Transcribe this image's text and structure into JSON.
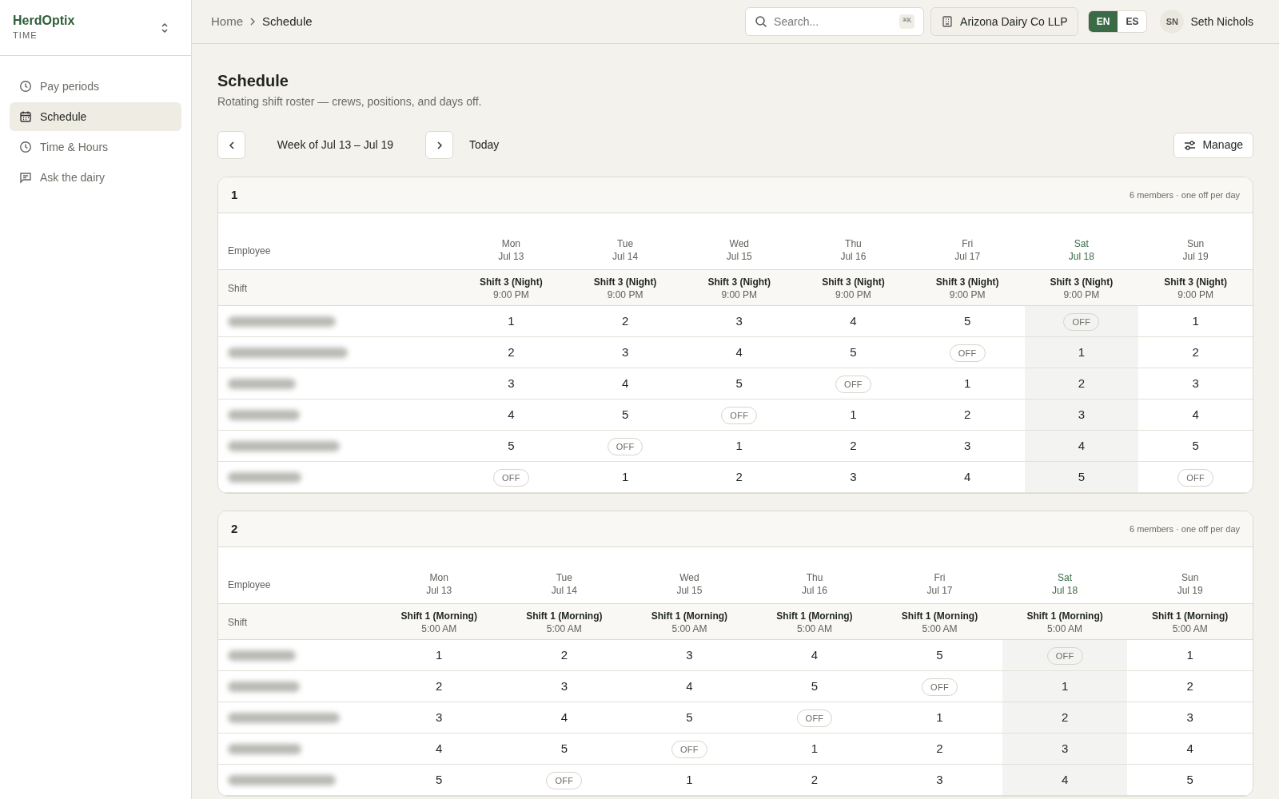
{
  "sidebar": {
    "brand": "HerdOptix",
    "product": "TIME",
    "items": [
      {
        "label": "Pay periods",
        "selected": false
      },
      {
        "label": "Schedule",
        "selected": true
      },
      {
        "label": "Time & Hours",
        "selected": false
      },
      {
        "label": "Ask the dairy",
        "selected": false
      }
    ]
  },
  "breadcrumb": [
    "Home",
    "Schedule"
  ],
  "topbar": {
    "search_placeholder": "Search...",
    "shortcut": "⌘K",
    "organization": "Arizona Dairy Co LLP",
    "languages": [
      {
        "label": "EN",
        "selected": true
      },
      {
        "label": "ES",
        "selected": false
      }
    ],
    "user_initials": "SN",
    "user_name": "Seth Nichols"
  },
  "page": {
    "title": "Schedule",
    "subtitle": "Rotating shift roster — crews, positions, and days off.",
    "week": "Week of Jul 13 – Jul 19",
    "today_button": "Today",
    "manage_button": "Manage"
  },
  "crews": [
    {
      "title": "1",
      "meta": "6 members · one off per day",
      "employee_header": "Employee",
      "shift_header": "Shift",
      "days": [
        {
          "day": "Mon",
          "date": "Jul 13",
          "shift": "Shift 3 (Night)",
          "time": "9:00 PM",
          "today": false
        },
        {
          "day": "Tue",
          "date": "Jul 14",
          "shift": "Shift 3 (Night)",
          "time": "9:00 PM",
          "today": false
        },
        {
          "day": "Wed",
          "date": "Jul 15",
          "shift": "Shift 3 (Night)",
          "time": "9:00 PM",
          "today": false
        },
        {
          "day": "Thu",
          "date": "Jul 16",
          "shift": "Shift 3 (Night)",
          "time": "9:00 PM",
          "today": false
        },
        {
          "day": "Fri",
          "date": "Jul 17",
          "shift": "Shift 3 (Night)",
          "time": "9:00 PM",
          "today": false
        },
        {
          "day": "Sat",
          "date": "Jul 18",
          "shift": "Shift 3 (Night)",
          "time": "9:00 PM",
          "today": true
        },
        {
          "day": "Sun",
          "date": "Jul 19",
          "shift": "Shift 3 (Night)",
          "time": "9:00 PM",
          "today": false
        }
      ],
      "rows": [
        {
          "cells": [
            {
              "kind": "position",
              "text": "1"
            },
            {
              "kind": "position",
              "text": "2"
            },
            {
              "kind": "position",
              "text": "3"
            },
            {
              "kind": "position",
              "text": "4"
            },
            {
              "kind": "position",
              "text": "5"
            },
            {
              "kind": "off",
              "text": "OFF"
            },
            {
              "kind": "position",
              "text": "1"
            }
          ]
        },
        {
          "cells": [
            {
              "kind": "position",
              "text": "2"
            },
            {
              "kind": "position",
              "text": "3"
            },
            {
              "kind": "position",
              "text": "4"
            },
            {
              "kind": "position",
              "text": "5"
            },
            {
              "kind": "off",
              "text": "OFF"
            },
            {
              "kind": "position",
              "text": "1"
            },
            {
              "kind": "position",
              "text": "2"
            }
          ]
        },
        {
          "cells": [
            {
              "kind": "position",
              "text": "3"
            },
            {
              "kind": "position",
              "text": "4"
            },
            {
              "kind": "position",
              "text": "5"
            },
            {
              "kind": "off",
              "text": "OFF"
            },
            {
              "kind": "position",
              "text": "1"
            },
            {
              "kind": "position",
              "text": "2"
            },
            {
              "kind": "position",
              "text": "3"
            }
          ]
        },
        {
          "cells": [
            {
              "kind": "position",
              "text": "4"
            },
            {
              "kind": "position",
              "text": "5"
            },
            {
              "kind": "off",
              "text": "OFF"
            },
            {
              "kind": "position",
              "text": "1"
            },
            {
              "kind": "position",
              "text": "2"
            },
            {
              "kind": "position",
              "text": "3"
            },
            {
              "kind": "position",
              "text": "4"
            }
          ]
        },
        {
          "cells": [
            {
              "kind": "position",
              "text": "5"
            },
            {
              "kind": "off",
              "text": "OFF"
            },
            {
              "kind": "position",
              "text": "1"
            },
            {
              "kind": "position",
              "text": "2"
            },
            {
              "kind": "position",
              "text": "3"
            },
            {
              "kind": "position",
              "text": "4"
            },
            {
              "kind": "position",
              "text": "5"
            }
          ]
        },
        {
          "cells": [
            {
              "kind": "off",
              "text": "OFF"
            },
            {
              "kind": "position",
              "text": "1"
            },
            {
              "kind": "position",
              "text": "2"
            },
            {
              "kind": "position",
              "text": "3"
            },
            {
              "kind": "position",
              "text": "4"
            },
            {
              "kind": "position",
              "text": "5"
            },
            {
              "kind": "off",
              "text": "OFF"
            }
          ]
        }
      ]
    },
    {
      "title": "2",
      "meta": "6 members · one off per day",
      "employee_header": "Employee",
      "shift_header": "Shift",
      "days": [
        {
          "day": "Mon",
          "date": "Jul 13",
          "shift": "Shift 1 (Morning)",
          "time": "5:00 AM",
          "today": false
        },
        {
          "day": "Tue",
          "date": "Jul 14",
          "shift": "Shift 1 (Morning)",
          "time": "5:00 AM",
          "today": false
        },
        {
          "day": "Wed",
          "date": "Jul 15",
          "shift": "Shift 1 (Morning)",
          "time": "5:00 AM",
          "today": false
        },
        {
          "day": "Thu",
          "date": "Jul 16",
          "shift": "Shift 1 (Morning)",
          "time": "5:00 AM",
          "today": false
        },
        {
          "day": "Fri",
          "date": "Jul 17",
          "shift": "Shift 1 (Morning)",
          "time": "5:00 AM",
          "today": false
        },
        {
          "day": "Sat",
          "date": "Jul 18",
          "shift": "Shift 1 (Morning)",
          "time": "5:00 AM",
          "today": true
        },
        {
          "day": "Sun",
          "date": "Jul 19",
          "shift": "Shift 1 (Morning)",
          "time": "5:00 AM",
          "today": false
        }
      ],
      "rows": [
        {
          "cells": [
            {
              "kind": "position",
              "text": "1"
            },
            {
              "kind": "position",
              "text": "2"
            },
            {
              "kind": "position",
              "text": "3"
            },
            {
              "kind": "position",
              "text": "4"
            },
            {
              "kind": "position",
              "text": "5"
            },
            {
              "kind": "off",
              "text": "OFF"
            },
            {
              "kind": "position",
              "text": "1"
            }
          ]
        },
        {
          "cells": [
            {
              "kind": "position",
              "text": "2"
            },
            {
              "kind": "position",
              "text": "3"
            },
            {
              "kind": "position",
              "text": "4"
            },
            {
              "kind": "position",
              "text": "5"
            },
            {
              "kind": "off",
              "text": "OFF"
            },
            {
              "kind": "position",
              "text": "1"
            },
            {
              "kind": "position",
              "text": "2"
            }
          ]
        },
        {
          "cells": [
            {
              "kind": "position",
              "text": "3"
            },
            {
              "kind": "position",
              "text": "4"
            },
            {
              "kind": "position",
              "text": "5"
            },
            {
              "kind": "off",
              "text": "OFF"
            },
            {
              "kind": "position",
              "text": "1"
            },
            {
              "kind": "position",
              "text": "2"
            },
            {
              "kind": "position",
              "text": "3"
            }
          ]
        },
        {
          "cells": [
            {
              "kind": "position",
              "text": "4"
            },
            {
              "kind": "position",
              "text": "5"
            },
            {
              "kind": "off",
              "text": "OFF"
            },
            {
              "kind": "position",
              "text": "1"
            },
            {
              "kind": "position",
              "text": "2"
            },
            {
              "kind": "position",
              "text": "3"
            },
            {
              "kind": "position",
              "text": "4"
            }
          ]
        },
        {
          "cells": [
            {
              "kind": "position",
              "text": "5"
            },
            {
              "kind": "off",
              "text": "OFF"
            },
            {
              "kind": "position",
              "text": "1"
            },
            {
              "kind": "position",
              "text": "2"
            },
            {
              "kind": "position",
              "text": "3"
            },
            {
              "kind": "position",
              "text": "4"
            },
            {
              "kind": "position",
              "text": "5"
            }
          ]
        }
      ]
    }
  ]
}
